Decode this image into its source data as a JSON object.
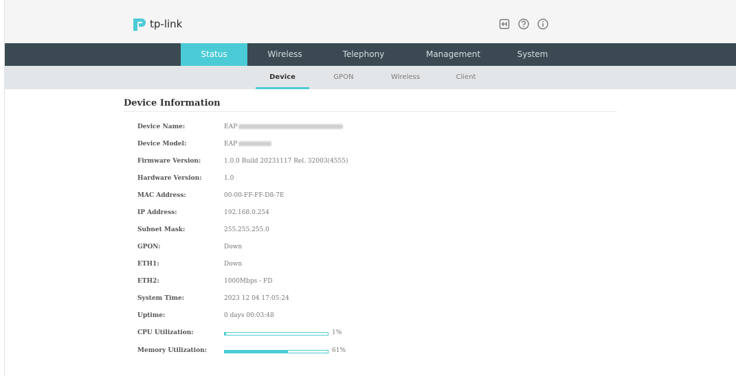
{
  "header": {
    "brand": "tp-link",
    "icons": [
      "logout-icon",
      "help-icon",
      "info-icon"
    ]
  },
  "main_nav": {
    "tabs": [
      {
        "label": "Status",
        "active": true
      },
      {
        "label": "Wireless",
        "active": false
      },
      {
        "label": "Telephony",
        "active": false
      },
      {
        "label": "Management",
        "active": false
      },
      {
        "label": "System",
        "active": false
      }
    ]
  },
  "sub_nav": {
    "tabs": [
      {
        "label": "Device",
        "active": true
      },
      {
        "label": "GPON",
        "active": false
      },
      {
        "label": "Wireless",
        "active": false
      },
      {
        "label": "Client",
        "active": false
      }
    ]
  },
  "section": {
    "title": "Device Information",
    "rows": [
      {
        "label": "Device Name:",
        "value": "EAP"
      },
      {
        "label": "Device Model:",
        "value": "EAP"
      },
      {
        "label": "Firmware Version:",
        "value": "1.0.0 Build 20231117 Rel. 32003(4555)"
      },
      {
        "label": "Hardware Version:",
        "value": "1.0"
      },
      {
        "label": "MAC Address:",
        "value": "00-00-FF-FF-D8-7E"
      },
      {
        "label": "IP Address:",
        "value": "192.168.0.254"
      },
      {
        "label": "Subnet Mask:",
        "value": "255.255.255.0"
      },
      {
        "label": "GPON:",
        "value": "Down"
      },
      {
        "label": "ETH1:",
        "value": "Down"
      },
      {
        "label": "ETH2:",
        "value": "1000Mbps - FD"
      },
      {
        "label": "System Time:",
        "value": "2023 12 04 17:05:24"
      },
      {
        "label": "Uptime:",
        "value": "0 days 00:03:48"
      }
    ],
    "cpu": {
      "label": "CPU Utilization:",
      "percent": 1,
      "text": "1%"
    },
    "memory": {
      "label": "Memory Utilization:",
      "percent": 61,
      "text": "61%"
    }
  },
  "colors": {
    "accent": "#4acbd6",
    "nav_bg": "#3b4a52",
    "subnav_bg": "#e3e6e8",
    "header_bg": "#f5f5f5",
    "logo_red": "#e8304a"
  }
}
